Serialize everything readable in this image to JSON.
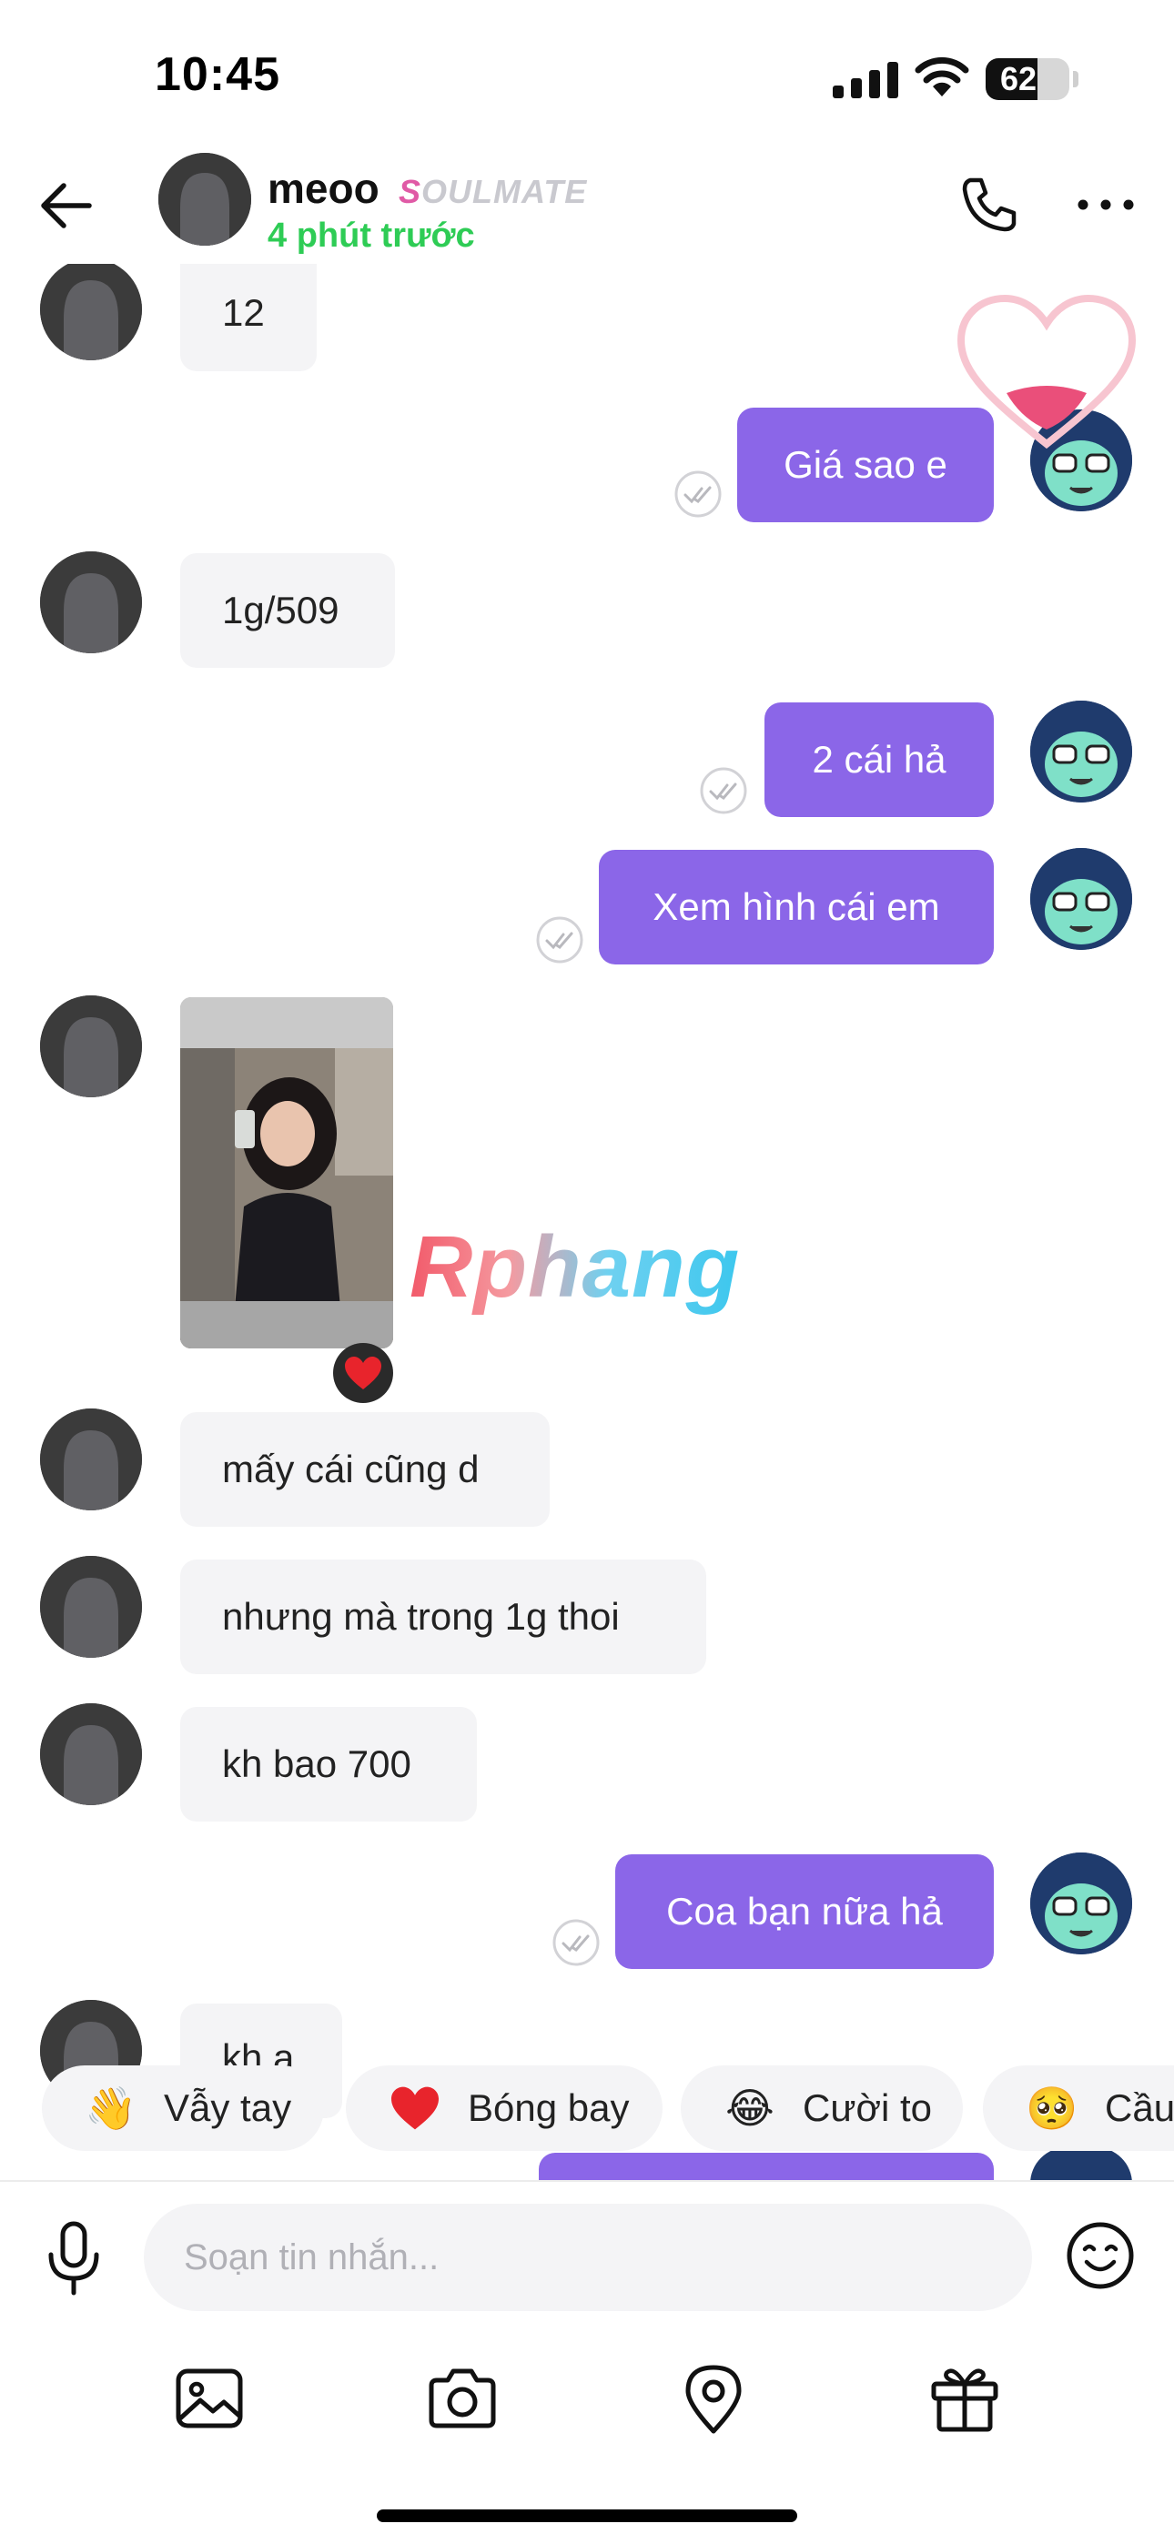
{
  "status_bar": {
    "time": "10:45",
    "battery": "62",
    "battery_level": 0.62
  },
  "header": {
    "name": "meoo",
    "badge_first": "S",
    "badge_rest": "OULMATE",
    "status": "4 phút trước",
    "icons": [
      "back-arrow-icon",
      "phone-icon",
      "more-icon"
    ]
  },
  "messages": [
    {
      "dir": "in",
      "text": "12"
    },
    {
      "dir": "out",
      "text": "Giá sao e"
    },
    {
      "dir": "in",
      "text": "1g/509"
    },
    {
      "dir": "out",
      "text": "2 cái hả"
    },
    {
      "dir": "out",
      "text": "Xem hình cái em"
    },
    {
      "dir": "in",
      "type": "photo",
      "reaction": "heart"
    },
    {
      "dir": "in",
      "text": "mấy cái cũng d"
    },
    {
      "dir": "in",
      "text": "nhưng mà trong 1g thoi"
    },
    {
      "dir": "in",
      "text": "kh bao 700"
    },
    {
      "dir": "out",
      "text": "Coa bạn nữa hả"
    },
    {
      "dir": "in",
      "text": "kh a"
    }
  ],
  "watermark": "Rphang",
  "quick_replies": [
    {
      "emoji": "👋",
      "label": "Vẫy tay"
    },
    {
      "emoji": "heart-icon",
      "label": "Bóng bay"
    },
    {
      "emoji": "😂",
      "label": "Cười to"
    },
    {
      "emoji": "🥺",
      "label": "Cầu"
    }
  ],
  "composer": {
    "placeholder": "Soạn tin nhắn..."
  },
  "toolbar": [
    "image-icon",
    "camera-icon",
    "location-icon",
    "gift-icon"
  ],
  "colors": {
    "accent": "#8b66e8",
    "online": "#2ecc55",
    "incoming_bg": "#f4f4f6"
  }
}
